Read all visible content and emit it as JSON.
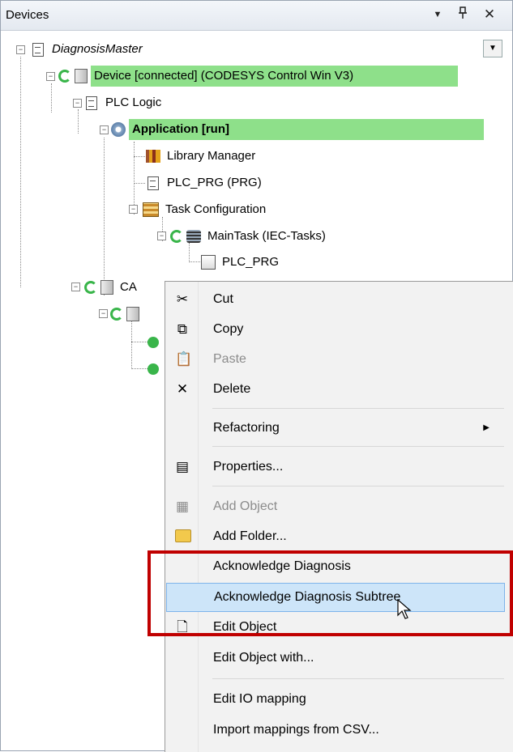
{
  "panel": {
    "title": "Devices",
    "dropdown_glyph": "▼",
    "pin_glyph": "ᵖ",
    "close_glyph": "✕",
    "scroll_dropdown_glyph": "▼"
  },
  "tree": {
    "root": "DiagnosisMaster",
    "device": "Device [connected] (CODESYS Control Win V3)",
    "plc_logic": "PLC Logic",
    "application": "Application [run]",
    "library_manager": "Library Manager",
    "plc_prg": "PLC_PRG (PRG)",
    "task_configuration": "Task Configuration",
    "main_task": "MainTask (IEC-Tasks)",
    "plc_prg_call": "PLC_PRG",
    "can_partial": "CA"
  },
  "menu": {
    "cut": "Cut",
    "copy": "Copy",
    "paste": "Paste",
    "delete": "Delete",
    "refactoring": "Refactoring",
    "properties": "Properties...",
    "add_object": "Add Object",
    "add_folder": "Add Folder...",
    "ack_diagnosis": "Acknowledge Diagnosis",
    "ack_diagnosis_subtree": "Acknowledge Diagnosis Subtree",
    "edit_object": "Edit Object",
    "edit_object_with": "Edit Object with...",
    "edit_io_mapping": "Edit IO mapping",
    "import_mappings": "Import mappings from CSV...",
    "submenu_arrow": "▶"
  },
  "icons": {
    "cut": "scissors-icon",
    "copy": "copy-icon",
    "paste": "paste-icon",
    "delete": "delete-icon",
    "properties": "properties-icon",
    "add_object": "add-object-icon",
    "add_folder": "folder-icon",
    "edit_object": "edit-object-icon"
  },
  "colors": {
    "highlight_green": "#8ee08a",
    "selection_blue": "#cde5f9",
    "annotation_red": "#c00000"
  }
}
